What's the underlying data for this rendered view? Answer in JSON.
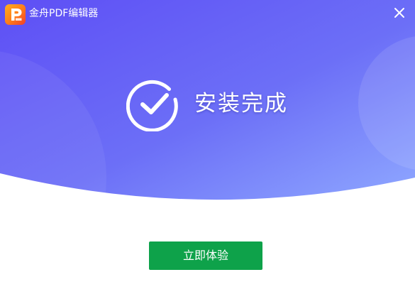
{
  "window": {
    "title": "金舟PDF编辑器",
    "close_icon": "close-icon",
    "logo_icon": "app-logo-icon",
    "logo_letter": "P"
  },
  "status": {
    "icon": "check-circle-icon",
    "text": "安装完成"
  },
  "actions": {
    "start_label": "立即体验"
  },
  "colors": {
    "gradient_start": "#6357f6",
    "gradient_end": "#8fa6ff",
    "button": "#0ea24a",
    "logo_orange": "#ff7a1a",
    "logo_red": "#f13e2b"
  }
}
